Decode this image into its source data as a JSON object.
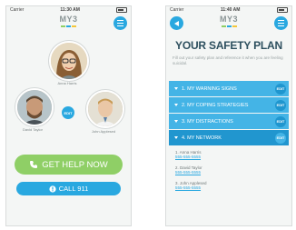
{
  "phone1": {
    "status": {
      "carrier": "Carrier",
      "time": "11:30 AM"
    },
    "logo": "MY3",
    "contacts": [
      {
        "name": "Anna Harris"
      },
      {
        "name": "David Taylor"
      },
      {
        "name": "John Applesed"
      }
    ],
    "edit_label": "EDIT",
    "help_button": "GET HELP NOW",
    "call_button": "CALL 911"
  },
  "phone2": {
    "status": {
      "carrier": "Carrier",
      "time": "11:40 AM"
    },
    "logo": "MY3",
    "title": "YOUR SAFETY PLAN",
    "subtitle": "Fill out your safety plan and reference it when you are feeling suicidal.",
    "sections": [
      {
        "label": "1. MY WARNING SIGNS",
        "edit": "EDIT"
      },
      {
        "label": "2. MY COPING STRATEGIES",
        "edit": "EDIT"
      },
      {
        "label": "3. MY DISTRACTIONS",
        "edit": "EDIT"
      },
      {
        "label": "4. MY NETWORK",
        "edit": "EDIT"
      }
    ],
    "network": [
      {
        "name": "1. Anna Harris",
        "phone": "555-555-5555"
      },
      {
        "name": "2. David Taylor",
        "phone": "555-555-5555"
      },
      {
        "name": "3. John Applesed",
        "phone": "555-555-5555"
      }
    ]
  },
  "colors": {
    "accent": "#29a8e0",
    "help_green": "#8fcf66",
    "title": "#2d4f5e"
  },
  "logo_dot_colors": [
    "#8fcf66",
    "#29a8e0",
    "#f3c73a"
  ]
}
